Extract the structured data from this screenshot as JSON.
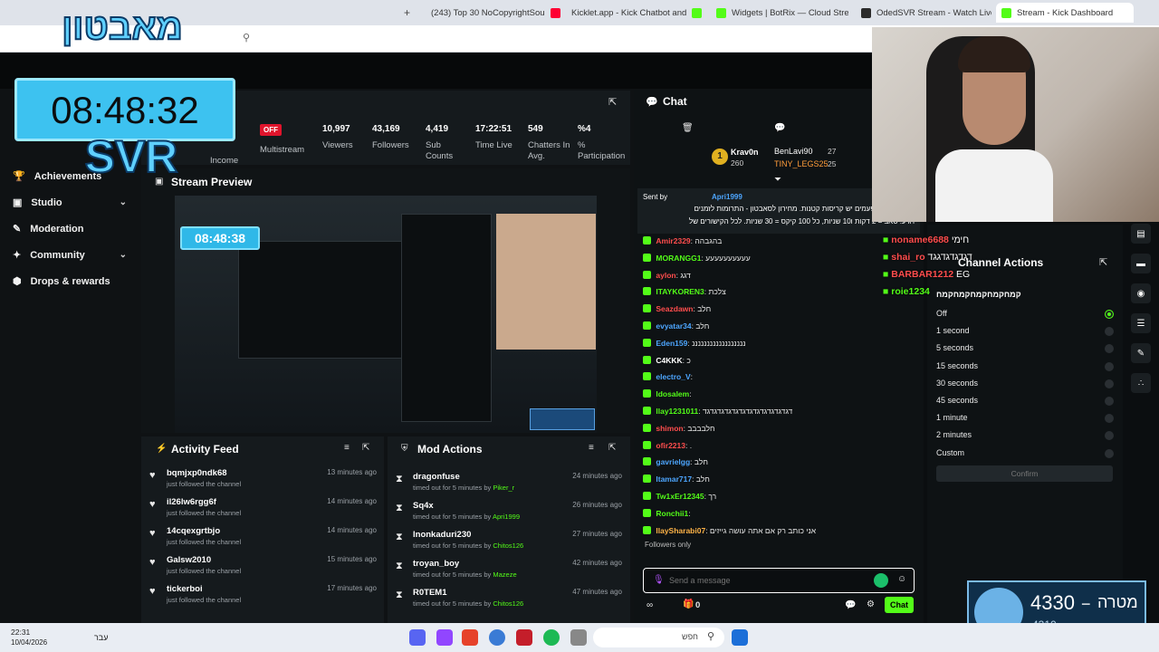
{
  "browser": {
    "tabs": [
      {
        "label": "(243) Top 30 NoCopyrightSou",
        "color": "#ff0033"
      },
      {
        "label": "Kicklet.app - Kick Chatbot and",
        "color": "#53fc18"
      },
      {
        "label": "Widgets | BotRix — Cloud Stre",
        "color": "#2b2b2b"
      },
      {
        "label": "OdedSVR Stream - Watch Live",
        "color": "#53fc18"
      },
      {
        "label": "Stream - Kick Dashboard",
        "color": "#53fc18"
      }
    ]
  },
  "overlay": {
    "clock": "08:48:32",
    "brand": "SVR",
    "logo_text": "מאבטון"
  },
  "sidebar": {
    "items": [
      {
        "label": "Achievements",
        "icon": "trophy-icon",
        "chevron": false
      },
      {
        "label": "Studio",
        "icon": "studio-icon",
        "chevron": true
      },
      {
        "label": "Moderation",
        "icon": "wrench-icon",
        "chevron": false
      },
      {
        "label": "Community",
        "icon": "people-icon",
        "chevron": true
      },
      {
        "label": "Drops & rewards",
        "icon": "gift-icon",
        "chevron": false
      }
    ]
  },
  "stats": {
    "income_label": "Income",
    "multistream_badge": "OFF",
    "multistream_label": "Multistream",
    "items": [
      {
        "value": "10,997",
        "label": "Viewers"
      },
      {
        "value": "43,169",
        "label": "Followers"
      },
      {
        "value": "4,419",
        "label": "Sub Counts"
      },
      {
        "value": "17:22:51",
        "label": "Time Live"
      },
      {
        "value": "549",
        "label": "Chatters In Avg."
      },
      {
        "value": "%4",
        "label": "% Participation"
      }
    ]
  },
  "preview": {
    "title": "Stream Preview",
    "mini_clock": "08:48:38"
  },
  "activity": {
    "title": "Activity Feed",
    "rows": [
      {
        "name": "bqmjxp0ndk68",
        "sub": "just followed the channel",
        "time": "13 minutes ago"
      },
      {
        "name": "il26lw6rgg6f",
        "sub": "just followed the channel",
        "time": "14 minutes ago"
      },
      {
        "name": "14cqexgrtbjo",
        "sub": "just followed the channel",
        "time": "14 minutes ago"
      },
      {
        "name": "Galsw2010",
        "sub": "just followed the channel",
        "time": "15 minutes ago"
      },
      {
        "name": "tickerboi",
        "sub": "just followed the channel",
        "time": "17 minutes ago"
      }
    ]
  },
  "mod": {
    "title": "Mod Actions",
    "rows": [
      {
        "name": "dragonfuse",
        "sub": "timed out for 5 minutes by",
        "by": "Piker_r",
        "time": "24 minutes ago"
      },
      {
        "name": "Sq4x",
        "sub": "timed out for 5 minutes by",
        "by": "Apri1999",
        "time": "26 minutes ago"
      },
      {
        "name": "lnonkaduri230",
        "sub": "timed out for 5 minutes by",
        "by": "Chitos126",
        "time": "27 minutes ago"
      },
      {
        "name": "troyan_boy",
        "sub": "timed out for 5 minutes by",
        "by": "Mazeze",
        "time": "42 minutes ago"
      },
      {
        "name": "R0TEM1",
        "sub": "timed out for 5 minutes by",
        "by": "Chitos126",
        "time": "47 minutes ago"
      }
    ]
  },
  "chat": {
    "title": "Chat",
    "leaders": {
      "rank1": "Krav0n",
      "rank1_score": "260",
      "second": [
        {
          "name": "BenLavi90",
          "score": "27"
        },
        {
          "name": "TINY_LEGS25",
          "score": "25"
        }
      ]
    },
    "pinned_sender": "Apri1999",
    "pinned_prefix": "Sent by",
    "pinned_text_1": "רך הביתה , לפעמים יש קריסות קטנות. מחירון לסאבטון - התרומות לזמנים",
    "pinned_text_2": "רגיע: סאב = 2 דקות ו10 שניות, כל 100 קיקס = 30 שניות. לכל הקישורים של",
    "messages": [
      {
        "user": "Amir2329",
        "color": "#ff4d4d",
        "text": "בהגבהה"
      },
      {
        "user": "MORANGG1",
        "color": "#53fc18",
        "text": "עעעעעעעעעע"
      },
      {
        "user": "aylon",
        "color": "#ff4d4d",
        "text": "דגג"
      },
      {
        "user": "ITAYKOREN3",
        "color": "#53fc18",
        "text": "צלכת"
      },
      {
        "user": "Seazdawn",
        "color": "#ff4d4d",
        "text": "חלב"
      },
      {
        "user": "evyatar34",
        "color": "#4da6ff",
        "text": "חלב"
      },
      {
        "user": "Eden159",
        "color": "#4da6ff",
        "text": "ננננננננננננננננננ"
      },
      {
        "user": "C4KKK",
        "color": "#ffffff",
        "text": "כ"
      },
      {
        "user": "electro_V",
        "color": "#4da6ff",
        "text": ""
      },
      {
        "user": "ldosalem",
        "color": "#53fc18",
        "text": ""
      },
      {
        "user": "llay1231011",
        "color": "#53fc18",
        "text": "דגדגדגדגדגדגדגדגדגדגדגדגד"
      },
      {
        "user": "shimon",
        "color": "#ff4d4d",
        "text": "חלבבבב"
      },
      {
        "user": "ofir2213",
        "color": "#ff4d4d",
        "text": "."
      },
      {
        "user": "gavrielgg",
        "color": "#4da6ff",
        "text": "חלב"
      },
      {
        "user": "ltamar717",
        "color": "#4da6ff",
        "text": "חלב"
      },
      {
        "user": "Tw1xEr12345",
        "color": "#53fc18",
        "text": "רך"
      },
      {
        "user": "Ronchii1",
        "color": "#53fc18",
        "text": ""
      },
      {
        "user": "llaySharabi07",
        "color": "#ffb347",
        "text": "אני כותב רק אם אתה עושה גייזים"
      }
    ],
    "followers_only": "Followers only",
    "input_placeholder": "Send a message",
    "send_label": "Chat",
    "count": "0"
  },
  "channel_actions": {
    "title": "Channel Actions",
    "subtitle": "קמחקמחקמחקמחקמח",
    "options": [
      "Off",
      "1 second",
      "5 seconds",
      "15 seconds",
      "30 seconds",
      "45 seconds",
      "1 minute",
      "2 minutes",
      "Custom"
    ],
    "selected_index": 0,
    "confirm": "Confirm"
  },
  "overlay_chat": [
    {
      "user": "noname6688",
      "color": "#ff4d4d",
      "text": "חימי"
    },
    {
      "user": "shai_ro",
      "color": "#ff4d4d",
      "text": "דגדגדגדגגד"
    },
    {
      "user": "BARBAR1212",
      "color": "#ff4d4d",
      "text": "EG"
    },
    {
      "user": "roie1234",
      "color": "#53fc18",
      "text": ""
    }
  ],
  "goal_widget": {
    "value": "4330",
    "label": "מטרה",
    "sub": "4310"
  },
  "taskbar": {
    "time": "22:31",
    "date": "10/04/2026",
    "lang": "עבר",
    "search": "חפש"
  }
}
